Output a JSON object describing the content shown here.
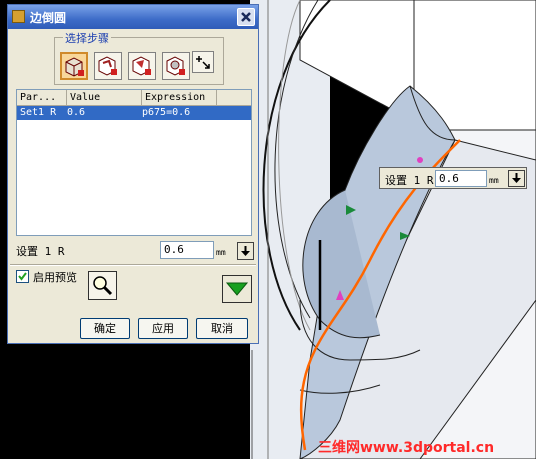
{
  "dialog": {
    "title": "边倒圆",
    "steps_label": "选择步骤",
    "table": {
      "columns": [
        "Par...",
        "Value",
        "Expression"
      ],
      "rows": [
        {
          "param": "Set1 R",
          "value": "0.6",
          "expression": "p675=0.6"
        }
      ]
    },
    "setting": {
      "label": "设置 1 R",
      "value": "0.6",
      "unit": "mm"
    },
    "preview": {
      "label": "启用预览",
      "checked": true
    },
    "buttons": {
      "ok": "确定",
      "apply": "应用",
      "cancel": "取消"
    }
  },
  "viewport_tip": {
    "label": "设置 1 R",
    "value": "0.6",
    "unit": "mm"
  },
  "watermark": "三维网www.3dportal.cn",
  "colors": {
    "titlebar": "#3d6cc8",
    "selection": "#316ac5",
    "edge_highlight": "#ff6600",
    "model_face": "#c9d6e8",
    "watermark": "#ff2a2a"
  }
}
